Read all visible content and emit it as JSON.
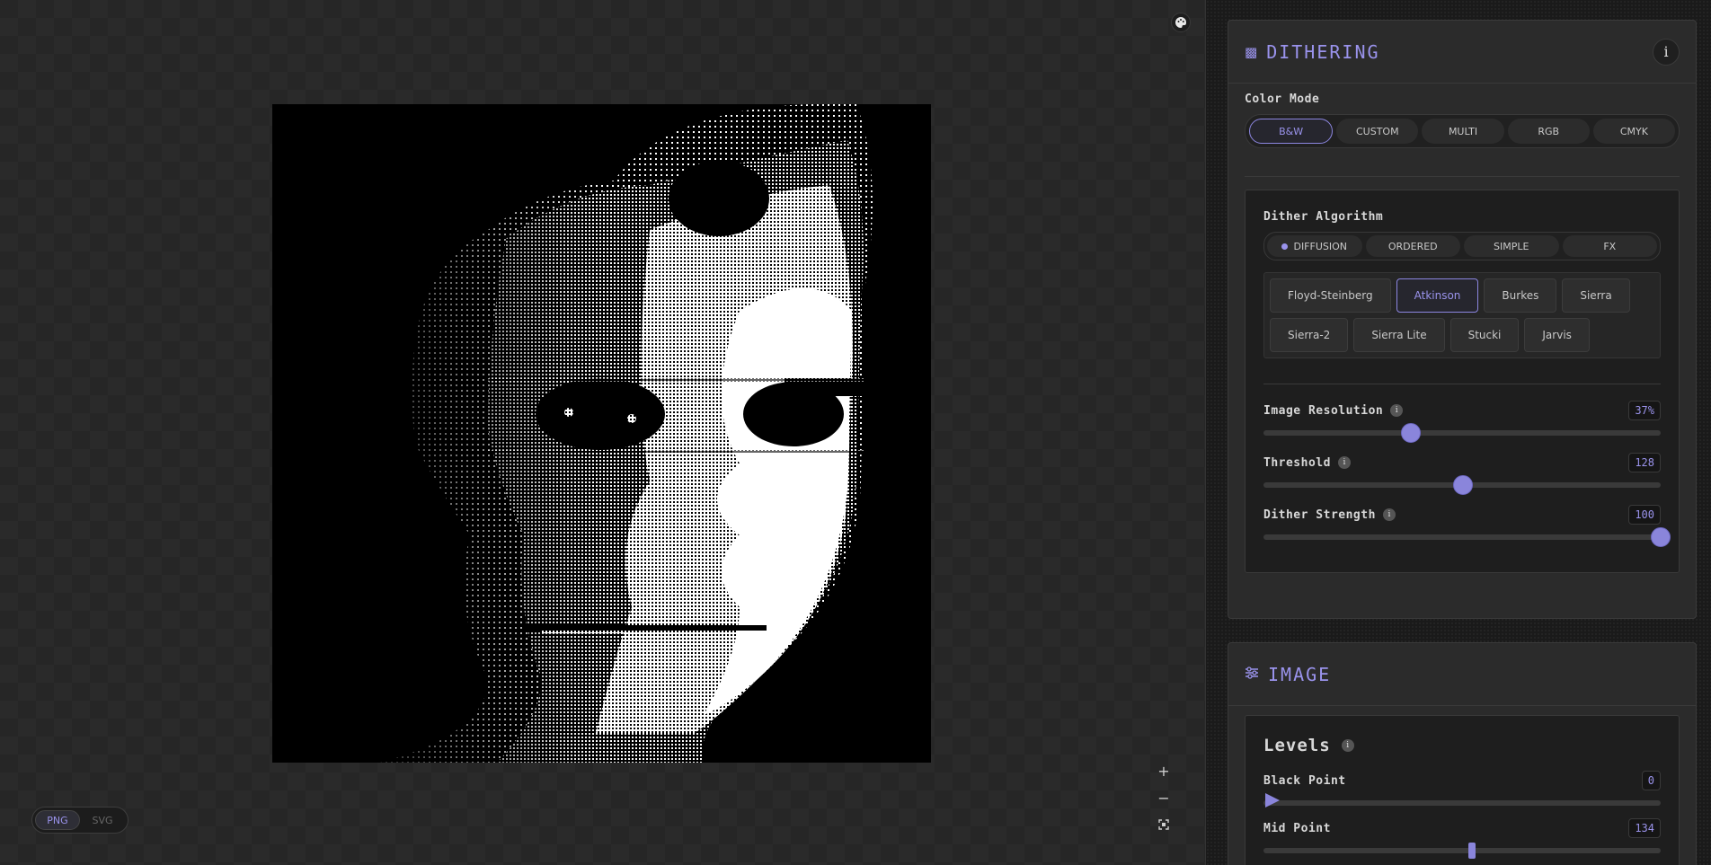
{
  "canvas": {
    "palette_icon": "palette-icon",
    "zoom_in_label": "+",
    "zoom_out_label": "−",
    "fit_icon": "fit-screen-icon",
    "export": {
      "png_label": "PNG",
      "svg_label": "SVG",
      "selected": "PNG"
    }
  },
  "dithering": {
    "title": "DITHERING",
    "icon": "dither-grid-icon",
    "info_label": "i",
    "color_mode": {
      "label": "Color Mode",
      "options": [
        "B&W",
        "CUSTOM",
        "MULTI",
        "RGB",
        "CMYK"
      ],
      "selected": "B&W"
    },
    "algorithm": {
      "label": "Dither Algorithm",
      "categories": [
        "DIFFUSION",
        "ORDERED",
        "SIMPLE",
        "FX"
      ],
      "selected_category": "DIFFUSION",
      "algorithms_row1": [
        "Floyd-Steinberg",
        "Atkinson",
        "Burkes",
        "Sierra"
      ],
      "algorithms_row2": [
        "Sierra-2",
        "Sierra Lite",
        "Stucki",
        "Jarvis"
      ],
      "selected": "Atkinson"
    },
    "sliders": {
      "resolution": {
        "label": "Image Resolution",
        "value_text": "37%",
        "value": 37,
        "min": 0,
        "max": 100
      },
      "threshold": {
        "label": "Threshold",
        "value_text": "128",
        "value": 128,
        "min": 0,
        "max": 255
      },
      "strength": {
        "label": "Dither Strength",
        "value_text": "100",
        "value": 100,
        "min": 0,
        "max": 100
      }
    }
  },
  "image_section": {
    "title": "IMAGE",
    "icon": "sliders-icon",
    "levels": {
      "title": "Levels",
      "black_point": {
        "label": "Black Point",
        "value_text": "0",
        "value": 0,
        "min": 0,
        "max": 255
      },
      "mid_point": {
        "label": "Mid Point",
        "value_text": "134",
        "value": 134,
        "min": 0,
        "max": 255
      }
    }
  },
  "colors": {
    "accent": "#9a93ec",
    "thumb": "#8a85db"
  }
}
